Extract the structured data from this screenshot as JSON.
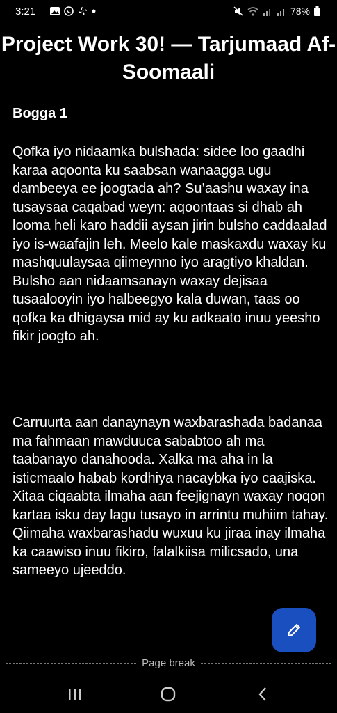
{
  "status": {
    "time": "3:21",
    "battery": "78%",
    "left_icons": [
      "image-icon",
      "whatsapp-icon",
      "fan-icon",
      "dot-icon"
    ],
    "right_icons": [
      "mute-icon",
      "wifi-icon",
      "signal-icon",
      "signal-icon",
      "battery-icon"
    ]
  },
  "document": {
    "title": "Project Work 30! — Tarjumaad Af-Soomaali",
    "page_heading": "Bogga 1",
    "paragraphs": [
      "Qofka iyo nidaamka bulshada: sidee loo gaadhi karaa aqoonta ku saabsan wanaagga ugu dambeeya ee joogtada ah? Su’aashu waxay ina tusaysaa caqabad weyn: aqoontaas si dhab ah looma heli karo haddii aysan jirin bulsho caddaalad iyo is-waafajin leh. Meelo kale maskaxdu waxay ku mashquulaysaa qiimeynno iyo aragtiyo khaldan. Bulsho aan nidaamsanayn waxay dejisaa tusaalooyin iyo halbeegyo kala duwan, taas oo qofka ka dhigaysa mid ay ku adkaato inuu yeesho fikir joogto ah.",
      "Carruurta aan danaynayn waxbarashada badanaa ma fahmaan mawduuca sababtoo ah ma taabanayo danahooda. Xalka ma aha in la isticmaalo habab kordhiya nacaybka iyo caajiska. Xitaa ciqaabta ilmaha aan feejignayn waxay noqon kartaa isku day lagu tusayo in arrintu muhiim tahay. Qiimaha waxbarashadu wuxuu ku jiraa inay ilmaha ka caawiso inuu fikiro, falalkiisa milicsado, una sameeyo ujeeddo."
    ],
    "page_break_label": "Page break"
  },
  "fab": {
    "icon": "pencil-icon",
    "color": "#1a4fc0"
  },
  "nav": {
    "icons": [
      "recents-icon",
      "home-icon",
      "back-icon"
    ]
  }
}
